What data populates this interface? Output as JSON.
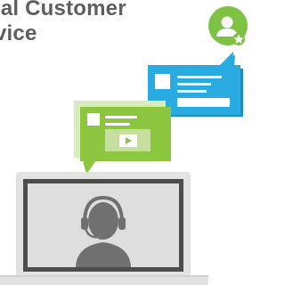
{
  "heading": {
    "line1": "ial Customer",
    "line2": "vice"
  },
  "icons": {
    "agent_badge": "user-star-badge-icon",
    "blue_message": "chat-message-bubble-icon",
    "green_message": "video-chat-bubble-icon",
    "laptop": "laptop-icon",
    "support_agent": "headset-agent-icon",
    "play": "play-icon"
  },
  "colors": {
    "heading_text": "#5e5e5e",
    "green_primary": "#8cc63f",
    "green_light": "#c6df9f",
    "green_badge": "#7dc242",
    "blue_primary": "#29abe2",
    "blue_dark": "#1c8fc4",
    "laptop_frame": "#e2e2e2",
    "laptop_screen_border": "#4d4d4d",
    "screen_bg": "#dedede",
    "agent_grey": "#707070"
  }
}
